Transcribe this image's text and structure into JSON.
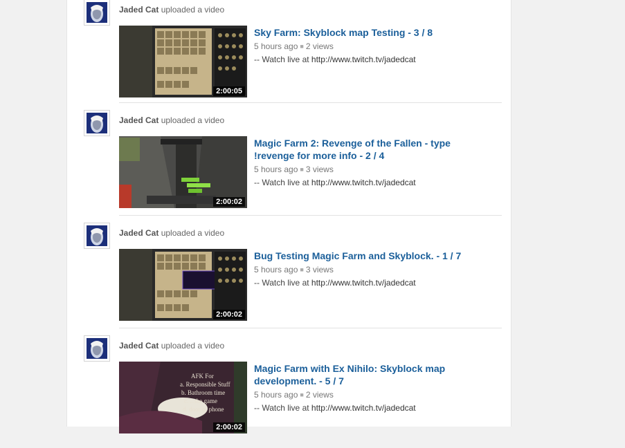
{
  "feed": {
    "items": [
      {
        "actor_name": "Jaded Cat",
        "action": "uploaded a video",
        "title": "Sky Farm: Skyblock map Testing - 3 / 8",
        "time_ago": "5 hours ago",
        "views": "2 views",
        "desc_prefix": "-- Watch live at ",
        "desc_url": "http://www.twitch.tv/jadedcat",
        "duration": "2:00:05"
      },
      {
        "actor_name": "Jaded Cat",
        "action": "uploaded a video",
        "title": "Magic Farm 2: Revenge of the Fallen - type !revenge for more info - 2 / 4",
        "time_ago": "5 hours ago",
        "views": "3 views",
        "desc_prefix": "-- Watch live at ",
        "desc_url": "http://www.twitch.tv/jadedcat",
        "duration": "2:00:02"
      },
      {
        "actor_name": "Jaded Cat",
        "action": "uploaded a video",
        "title": "Bug Testing Magic Farm and Skyblock. - 1 / 7",
        "time_ago": "5 hours ago",
        "views": "3 views",
        "desc_prefix": "-- Watch live at ",
        "desc_url": "http://www.twitch.tv/jadedcat",
        "duration": "2:00:02"
      },
      {
        "actor_name": "Jaded Cat",
        "action": "uploaded a video",
        "title": "Magic Farm with Ex Nihilo: Skyblock map development. - 5 / 7",
        "time_ago": "5 hours ago",
        "views": "2 views",
        "desc_prefix": "-- Watch live at ",
        "desc_url": "http://www.twitch.tv/jadedcat",
        "duration": "2:00:02",
        "thumb_text": [
          "AFK For",
          "a. Responsible Stuff",
          "b. Bathroom time",
          "c. ...the game",
          "d. door or phone"
        ]
      }
    ]
  },
  "colors": {
    "title_link": "#1b5f9a",
    "accent": "#e62117"
  }
}
